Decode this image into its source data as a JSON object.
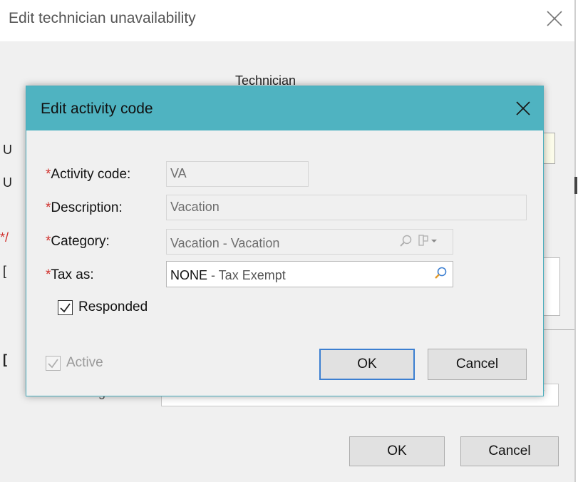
{
  "outer": {
    "title": "Edit technician unavailability",
    "section_label": "Technician",
    "assign_label": "Assign to:",
    "ok_label": "OK",
    "cancel_label": "Cancel",
    "stubs": [
      "U",
      "U",
      "*/",
      "[",
      "["
    ]
  },
  "dialog": {
    "title": "Edit activity code",
    "required_mark": "*",
    "activity_code": {
      "label": "Activity code:",
      "value": "VA"
    },
    "description": {
      "label": "Description:",
      "value": "Vacation"
    },
    "category": {
      "label": "Category:",
      "value": "Vacation - Vacation"
    },
    "tax_as": {
      "label": "Tax as:",
      "code": "NONE",
      "desc": " - Tax Exempt"
    },
    "responded": {
      "label": "Responded",
      "checked": true
    },
    "active": {
      "label": "Active",
      "checked": true,
      "disabled": true
    },
    "ok_label": "OK",
    "cancel_label": "Cancel"
  },
  "colors": {
    "titlebar": "#4fb3c1",
    "required": "#d0312d",
    "lookup_icon": "#e39b2a",
    "focus_border": "#3c7fd1"
  },
  "icons": [
    "close-icon",
    "magnifier-icon",
    "dropdown-icon",
    "checkmark-icon"
  ]
}
